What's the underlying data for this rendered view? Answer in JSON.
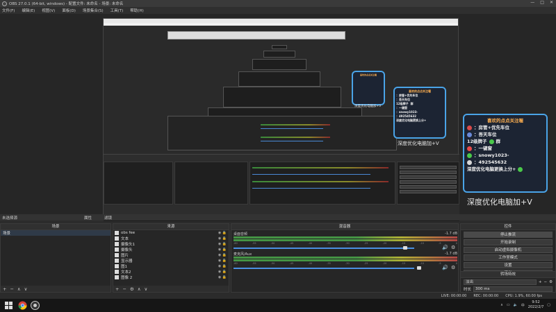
{
  "window": {
    "title": "OBS 27.0.1 (64-bit, windows) - 配置文件: 未命名 - 场景: 未命名",
    "controls": [
      "—",
      "□",
      "✕"
    ]
  },
  "menu": [
    "文件(F)",
    "编辑(E)",
    "视图(V)",
    "面板(D)",
    "场景集合(S)",
    "工具(T)",
    "帮助(H)"
  ],
  "dock_strip": {
    "label": "未选择源",
    "properties": "属性",
    "filters": "滤镜"
  },
  "scenes": {
    "header": "场景",
    "items": [
      "场景"
    ]
  },
  "sources": {
    "header": "来源",
    "items": [
      {
        "label": "obs fee",
        "icon": "text-icon"
      },
      {
        "label": "文本",
        "icon": "image-icon"
      },
      {
        "label": "摄像头1",
        "icon": "image-icon"
      },
      {
        "label": "摄像头",
        "icon": "image-icon"
      },
      {
        "label": "图片",
        "icon": "image-icon"
      },
      {
        "label": "显示器",
        "icon": "image-icon"
      },
      {
        "label": "图1",
        "icon": "image-icon"
      },
      {
        "label": "文本2",
        "icon": "text-icon"
      },
      {
        "label": "图像 2",
        "icon": "image-icon"
      }
    ]
  },
  "mixer": {
    "header": "混音器",
    "tracks": [
      {
        "name": "桌面音频",
        "db": "-1.7 dB"
      },
      {
        "name": "麦克风/Aux",
        "db": "-1.7 dB"
      }
    ],
    "ticks": [
      "-60",
      "-55",
      "-50",
      "-45",
      "-40",
      "-35",
      "-30",
      "-25",
      "-20",
      "-15",
      "-10",
      "-5",
      "0"
    ]
  },
  "controls": {
    "header": "控件",
    "buttons": [
      "停止推流",
      "开始录制",
      "启动虚拟摄像机",
      "工作室模式",
      "设置",
      "退出"
    ]
  },
  "transitions": {
    "header": "转场特效",
    "selected": "淡出",
    "duration_label": "时长",
    "duration_value": "300 ms"
  },
  "statusbar": {
    "live": "LIVE: 00:00:00",
    "rec": "REC: 00:00:00",
    "cpu": "CPU: 1.9%, 60.00 fps"
  },
  "taskbar": {
    "time": "9:52",
    "date": "2022/2/7"
  },
  "promo": {
    "heading": "喜欢的点点关注喔",
    "lines": [
      "：房管+优先车位",
      "：吾天车位",
      "12级牌子",
      "群",
      "：一键窗",
      "：snowy1023-",
      "：492545632",
      "深度优化电脑更换上分+"
    ],
    "caption": "深度优化电脑加+V"
  }
}
